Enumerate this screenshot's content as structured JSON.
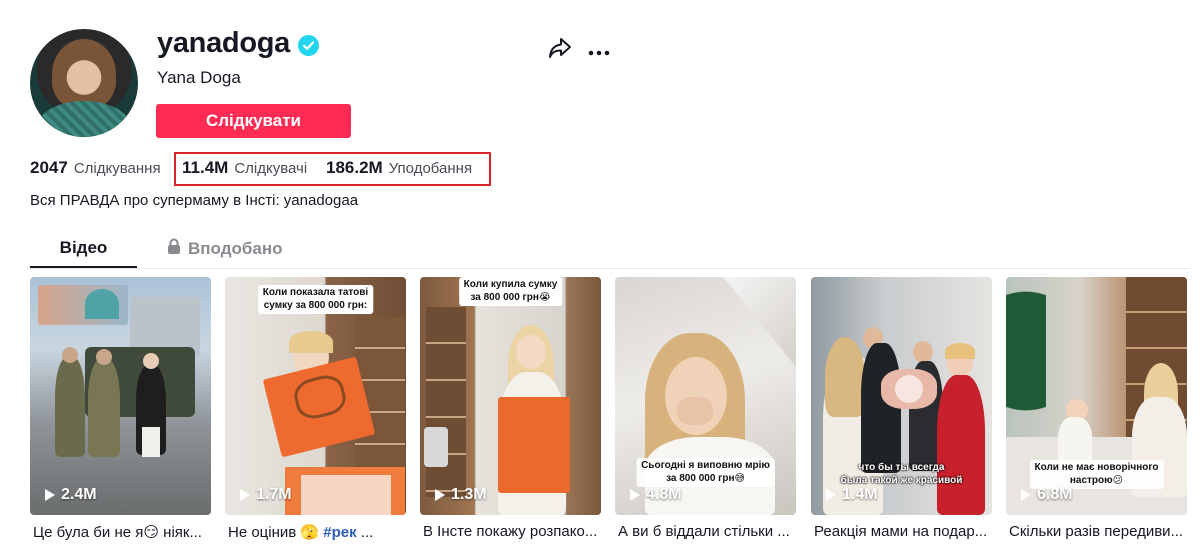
{
  "profile": {
    "username": "yanadoga",
    "nickname": "Yana Doga",
    "follow_label": "Слідкувати",
    "bio": "Вся ПРАВДА про супермаму в Інсті: yanadogaa"
  },
  "stats": {
    "following_count": "2047",
    "following_label": "Слідкування",
    "followers_count": "11.4M",
    "followers_label": "Слідкувачі",
    "likes_count": "186.2M",
    "likes_label": "Уподобання"
  },
  "tabs": {
    "videos": "Відео",
    "liked": "Вподобано"
  },
  "icons": {
    "verified": "verified-badge-icon",
    "share": "share-icon",
    "more": "more-icon",
    "lock": "lock-icon",
    "play": "play-icon"
  },
  "colors": {
    "accent": "#fe2c55",
    "verified": "#20d5ec",
    "highlight": "#d9252f",
    "tag": "#2b5db9"
  },
  "videos": [
    {
      "views": "2.4M",
      "caption_text": "Це була би не я😏 ніяк...",
      "overlay_top": "",
      "overlay_bottom": ""
    },
    {
      "views": "1.7M",
      "caption_text": "Не оцінив 🫣 ",
      "caption_tag": "#рек",
      "caption_tail": " ...",
      "overlay_top": "Коли показала татові\nсумку за 800 000 грн:",
      "overlay_bottom": ""
    },
    {
      "views": "1.3M",
      "caption_text": "В Інсте покажу розпако...",
      "overlay_top": "Коли купила сумку\nза 800 000 грн😭",
      "overlay_bottom": ""
    },
    {
      "views": "4.8M",
      "caption_text": "А ви б віддали стільки ...",
      "overlay_top": "",
      "overlay_bottom": "Сьогодні я виповню мрію\nза 800 000 грн😅"
    },
    {
      "views": "1.4M",
      "caption_text": "Реакція мами на подар...",
      "overlay_top": "",
      "overlay_bottom": "что бы ты всегда\nбыла такой же красивой"
    },
    {
      "views": "6.8M",
      "caption_text": "Скільки разів передиви...",
      "overlay_top": "",
      "overlay_bottom": "Коли не має новорічного\nнастрою😕"
    }
  ]
}
